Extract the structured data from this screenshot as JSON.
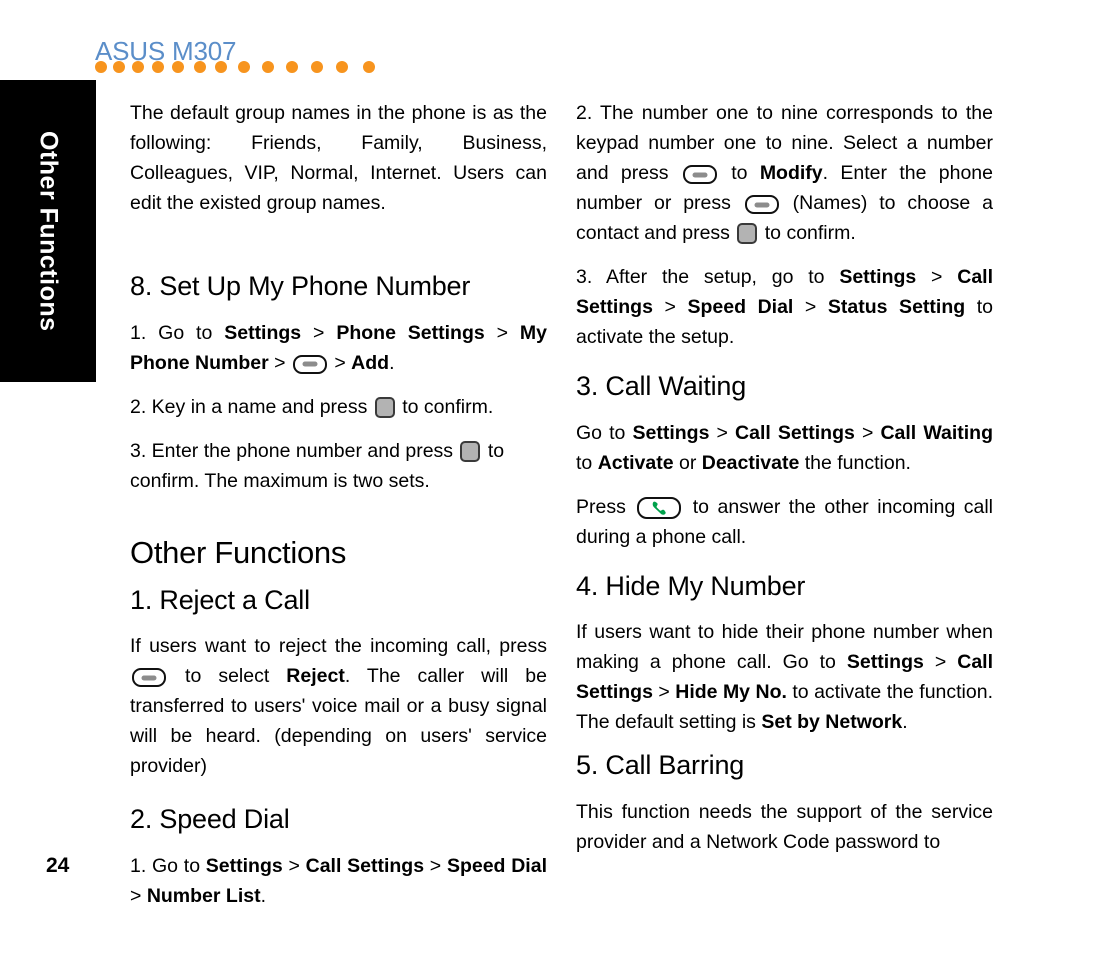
{
  "header": {
    "brand": "ASUS M307",
    "dot_color": "#f7941e",
    "brand_color": "#5b8ec9",
    "dot_count": 13
  },
  "side_tab": {
    "label": "Other Functions",
    "background": "#000000",
    "text_color": "#ffffff"
  },
  "page_number": "24",
  "icons": {
    "softkey": "softkey-icon",
    "ok_key": "ok-key-icon",
    "call_key": "call-key-icon"
  },
  "left_column": {
    "intro_paragraph": {
      "text": "The default group names in the phone is as the following: Friends, Family, Business, Colleagues, VIP, Normal, Internet. Users can edit the existed group names."
    },
    "section_8": {
      "heading": "8. Set Up My Phone Number",
      "step1": {
        "prefix": "1. Go to ",
        "b1": "Settings",
        "sep1": " > ",
        "b2": "Phone Settings",
        "sep2": " > ",
        "b3": "My Phone Number",
        "sep3": " > ",
        "sep4": " > ",
        "b4": "Add",
        "suffix": "."
      },
      "step2": {
        "prefix": "2. Key in a name and press ",
        "suffix": " to confirm."
      },
      "step3": {
        "prefix": "3. Enter the phone number and press ",
        "suffix": " to confirm. The maximum is two sets."
      }
    },
    "chapter_heading": "Other Functions",
    "section_1": {
      "heading": "1. Reject a Call",
      "body_prefix": "If users want to reject the incoming call, press ",
      "body_mid": " to select ",
      "body_bold": "Reject",
      "body_suffix": ". The caller will be transferred to users' voice mail or a busy signal will be heard. (depending on users' service provider)"
    },
    "section_2": {
      "heading": "2. Speed Dial",
      "step1": {
        "prefix": "1. Go to ",
        "b1": "Settings",
        "sep1": " > ",
        "b2": "Call Settings",
        "sep2": " > ",
        "b3": "Speed Dial",
        "sep3": " > ",
        "b4": "Number List",
        "suffix": "."
      }
    }
  },
  "right_column": {
    "speed_dial_step2": {
      "p1": "2. The number one to nine corresponds to the keypad number one to nine. Select a number and press ",
      "p2": " to ",
      "b1": "Modify",
      "p3": ". Enter the phone number or press ",
      "p4": " (Names) to choose a contact and press ",
      "p5": " to confirm."
    },
    "speed_dial_step3": {
      "prefix": "3. After the setup, go to ",
      "b1": "Settings",
      "sep1": " > ",
      "b2": "Call Settings",
      "sep2": " > ",
      "b3": "Speed Dial",
      "sep3": " > ",
      "b4": "Status Setting",
      "suffix": " to activate the setup."
    },
    "section_3": {
      "heading": "3. Call Waiting",
      "p1": {
        "prefix": "Go to ",
        "b1": "Settings",
        "sep1": " > ",
        "b2": "Call Settings",
        "sep2": " > ",
        "b3": "Call Waiting",
        "mid": " to ",
        "b4": "Activate",
        "mid2": " or ",
        "b5": "Deactivate",
        "suffix": " the function."
      },
      "p2": {
        "prefix": "Press ",
        "suffix": " to answer the other incoming call during a phone call."
      }
    },
    "section_4": {
      "heading": "4. Hide My Number",
      "body": {
        "prefix": "If users want to hide their phone number when making a phone call. Go to ",
        "b1": "Settings",
        "sep1": " > ",
        "b2": "Call Settings",
        "sep2": " > ",
        "b3": "Hide My No.",
        "mid": " to activate the function. The default setting is ",
        "b4": "Set by Network",
        "suffix": "."
      }
    },
    "section_5": {
      "heading": "5. Call Barring",
      "body": "This function needs the support of the service provider and a Network Code password to"
    }
  }
}
